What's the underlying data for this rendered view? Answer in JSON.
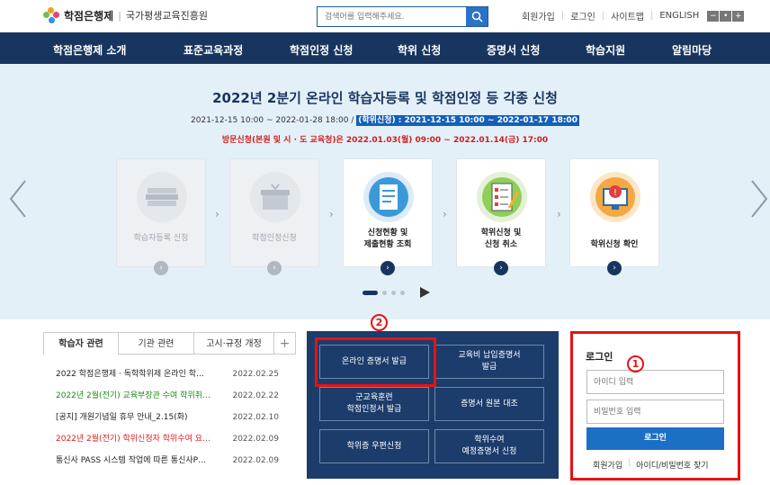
{
  "header": {
    "logo_text": "학점은행제",
    "logo_sub": "국가평생교육진흥원",
    "search_placeholder": "검색어를 입력해주세요.",
    "util_links": [
      "회원가입",
      "로그인",
      "사이트맵",
      "ENGLISH"
    ],
    "zoom": [
      "−",
      "•",
      "+"
    ]
  },
  "nav": {
    "items": [
      "학점은행제 소개",
      "표준교육과정",
      "학점인정 신청",
      "학위 신청",
      "증명서 신청",
      "학습지원",
      "알림마당"
    ]
  },
  "hero": {
    "title": "2022년 2분기 온라인 학습자등록 및 학점인정 등 각종 신청",
    "date_main": "2021-12-15 10:00 ~ 2022-01-28 18:00 / ",
    "date_highlight": "(학위신청) : 2021-12-15 10:00 ~ 2022-01-17 18:00",
    "visit": "방문신청(본원 및 시 · 도 교육청)은 2022.01.03(월) 09:00 ~ 2022.01.14(금) 17:00",
    "cards": [
      {
        "label": "학습자등록 신청",
        "active": false,
        "icon": "books-icon"
      },
      {
        "label": "학점인정신청",
        "active": false,
        "icon": "box-icon"
      },
      {
        "label": "신청현황 및\n제출현황 조회",
        "active": true,
        "icon": "document-icon"
      },
      {
        "label": "학위신청 및\n신청 취소",
        "active": true,
        "icon": "checklist-icon"
      },
      {
        "label": "학위신청 확인",
        "active": true,
        "icon": "alert-screen-icon"
      }
    ],
    "card_go": "›",
    "chevron": "›"
  },
  "tabs": {
    "items": [
      "학습자 관련",
      "기관 관련",
      "고시·규정 개정"
    ],
    "plus": "+"
  },
  "news": [
    {
      "title": "2022 학점은행제 · 독학학위제 온라인 학…",
      "date": "2022.02.25",
      "color": "#222222"
    },
    {
      "title": "2022년 2월(전기) 교육부장관 수여 학위취…",
      "date": "2022.02.22",
      "color": "#1a8a1a"
    },
    {
      "title": "[공지] 개원기념일 휴무 안내_2.15(화)",
      "date": "2022.02.10",
      "color": "#222222"
    },
    {
      "title": "2022년 2월(전기) 학위신청자 학위수여 요…",
      "date": "2022.02.09",
      "color": "#e01a1a"
    },
    {
      "title": "통신사 PASS 시스템 작업에 따른 통신사P…",
      "date": "2022.02.09",
      "color": "#222222"
    }
  ],
  "cert": {
    "buttons": [
      "온라인 증명서 발급",
      "교육비 납입증명서\n발급",
      "군교육훈련\n학점인정서 발급",
      "증명서 원본 대조",
      "학위증 우편신청",
      "학위수여\n예정증명서 신청"
    ]
  },
  "login": {
    "title": "로그인",
    "id_placeholder": "아이디 입력",
    "pw_placeholder": "비밀번호 입력",
    "button": "로그인",
    "links": [
      "회원가입",
      "아이디/비밀번호 찾기"
    ]
  },
  "annotations": {
    "badge1": "1",
    "badge2": "2"
  },
  "colors": {
    "navy": "#17355f",
    "highlight_red": "#e81212",
    "blue": "#1b6fc4"
  }
}
